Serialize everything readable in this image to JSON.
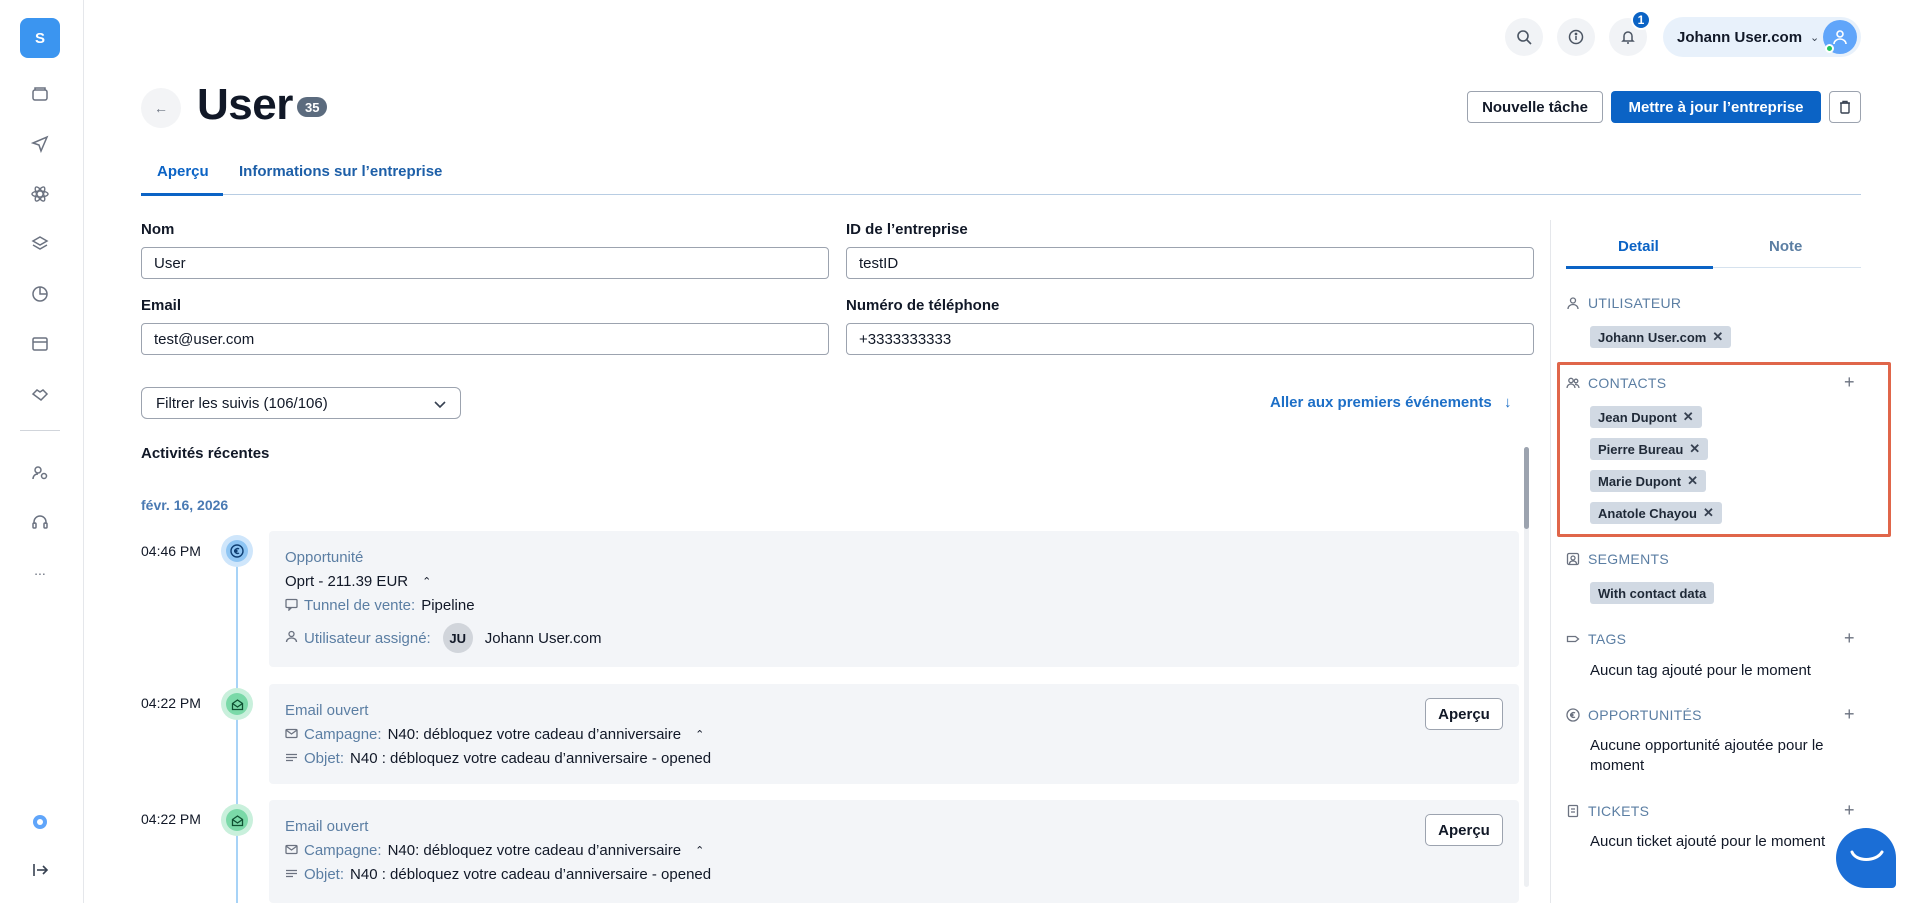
{
  "sidebar": {
    "logo_letter": "S",
    "items": [
      {
        "icon": "folder-icon"
      },
      {
        "icon": "send-icon"
      },
      {
        "icon": "atom-icon"
      },
      {
        "icon": "layers-icon"
      },
      {
        "icon": "pie-chart-icon"
      },
      {
        "icon": "window-icon"
      },
      {
        "icon": "handshake-icon"
      },
      {
        "icon": "user-gear-icon"
      },
      {
        "icon": "headset-icon"
      },
      {
        "icon": "more-icon",
        "label": "..."
      }
    ],
    "bottom": [
      {
        "icon": "help-circle-icon"
      },
      {
        "icon": "collapse-icon"
      }
    ]
  },
  "topbar": {
    "notification_count": "1",
    "user_name": "Johann User.com"
  },
  "header": {
    "title": "User",
    "count": "35",
    "new_task_label": "Nouvelle tâche",
    "update_label": "Mettre à jour l’entreprise"
  },
  "tabs": [
    {
      "label": "Aperçu",
      "active": true
    },
    {
      "label": "Informations sur l’entreprise",
      "active": false
    }
  ],
  "form": {
    "name_label": "Nom",
    "name_value": "User",
    "company_id_label": "ID de l’entreprise",
    "company_id_value": "testID",
    "email_label": "Email",
    "email_value": "test@user.com",
    "phone_label": "Numéro de téléphone",
    "phone_value": "+3333333333"
  },
  "activity": {
    "filter_label": "Filtrer les suivis (106/106)",
    "first_events_label": "Aller aux premiers événements",
    "recent_title": "Activités récentes",
    "date": "févr. 16, 2026",
    "items": [
      {
        "time": "04:46 PM",
        "title": "Opportunité",
        "line1": "Oprt - 211.39 EUR",
        "pipeline_key": "Tunnel de vente:",
        "pipeline_value": "Pipeline",
        "assigned_key": "Utilisateur assigné:",
        "assigned_initials": "JU",
        "assigned_name": "Johann User.com"
      },
      {
        "time": "04:22 PM",
        "title": "Email ouvert",
        "campaign_key": "Campagne:",
        "campaign_value": "N40: débloquez votre cadeau d’anniversaire",
        "subject_key": "Objet:",
        "subject_value": "N40 : débloquez votre cadeau d’anniversaire - opened",
        "button": "Aperçu"
      },
      {
        "time": "04:22 PM",
        "title": "Email ouvert",
        "campaign_key": "Campagne:",
        "campaign_value": "N40: débloquez votre cadeau d’anniversaire",
        "subject_key": "Objet:",
        "subject_value": "N40 : débloquez votre cadeau d’anniversaire - opened",
        "button": "Aperçu"
      }
    ]
  },
  "panel": {
    "tabs": [
      {
        "label": "Detail",
        "active": true
      },
      {
        "label": "Note",
        "active": false
      }
    ],
    "user_title": "UTILISATEUR",
    "user_chip": "Johann User.com",
    "contacts_title": "CONTACTS",
    "contacts": [
      "Jean Dupont",
      "Pierre Bureau",
      "Marie Dupont",
      "Anatole Chayou"
    ],
    "segments_title": "SEGMENTS",
    "segment_chip": "With contact data",
    "tags_title": "TAGS",
    "tags_empty": "Aucun tag ajouté pour le moment",
    "opps_title": "OPPORTUNITÉS",
    "opps_empty": "Aucune opportunité ajoutée pour le moment",
    "tickets_title": "TICKETS",
    "tickets_empty": "Aucun ticket ajouté pour le moment"
  },
  "colors": {
    "primary": "#0b63c5",
    "highlight": "#e0664a"
  }
}
